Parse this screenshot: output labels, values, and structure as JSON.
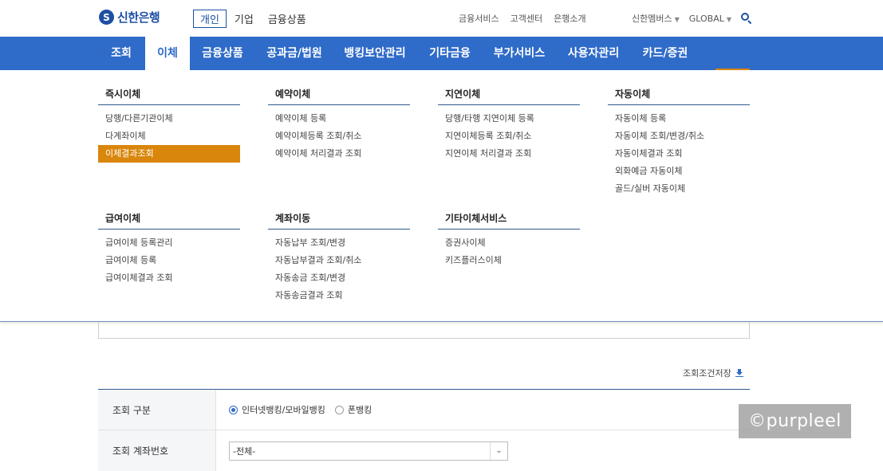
{
  "header": {
    "logo_mark": "S",
    "logo_text": "신한은행",
    "segments": [
      "개인",
      "기업",
      "금융상품"
    ],
    "util_links": [
      "금융서비스",
      "고객센터",
      "은행소개"
    ],
    "members_label": "신한멤버스",
    "lang_label": "GLOBAL"
  },
  "gnb": {
    "items": [
      "조회",
      "이체",
      "금융상품",
      "공과금/법원",
      "뱅킹보안관리",
      "기타금융",
      "부가서비스",
      "사용자관리",
      "카드/증권"
    ],
    "active": "이체"
  },
  "mega_menu": {
    "columns": [
      {
        "title": "즉시이체",
        "items": [
          "당행/다른기관이체",
          "다계좌이체",
          "이체결과조회"
        ]
      },
      {
        "title": "예약이체",
        "items": [
          "예약이체 등록",
          "예약이체등록 조회/취소",
          "예약이체 처리결과 조회"
        ]
      },
      {
        "title": "지연이체",
        "items": [
          "당행/타행 지연이체 등록",
          "지연이체등록 조회/취소",
          "지연이체 처리결과 조회"
        ]
      },
      {
        "title": "자동이체",
        "items": [
          "자동이체 등록",
          "자동이체 조회/변경/취소",
          "자동이체결과 조회",
          "외화예금 자동이체",
          "골드/실버 자동이체"
        ]
      },
      {
        "title": "급여이체",
        "items": [
          "급여이체 등록관리",
          "급여이체 등록",
          "급여이체결과 조회"
        ]
      },
      {
        "title": "계좌이동",
        "items": [
          "자동납부 조회/변경",
          "자동납부결과 조회/취소",
          "자동송금 조회/변경",
          "자동송금결과 조회"
        ]
      },
      {
        "title": "기타이체서비스",
        "items": [
          "증권사이체",
          "키즈플러스이체"
        ]
      }
    ],
    "selected_item": "이체결과조회"
  },
  "page": {
    "save_condition_label": "조회조건저장",
    "form": {
      "row1_label": "조회 구분",
      "radio_options": [
        "인터넷뱅킹/모바일뱅킹",
        "폰뱅킹"
      ],
      "radio_selected": "인터넷뱅킹/모바일뱅킹",
      "row2_label": "조회 계좌번호",
      "account_select_value": "-전체-"
    }
  },
  "watermark": "©purpleel"
}
